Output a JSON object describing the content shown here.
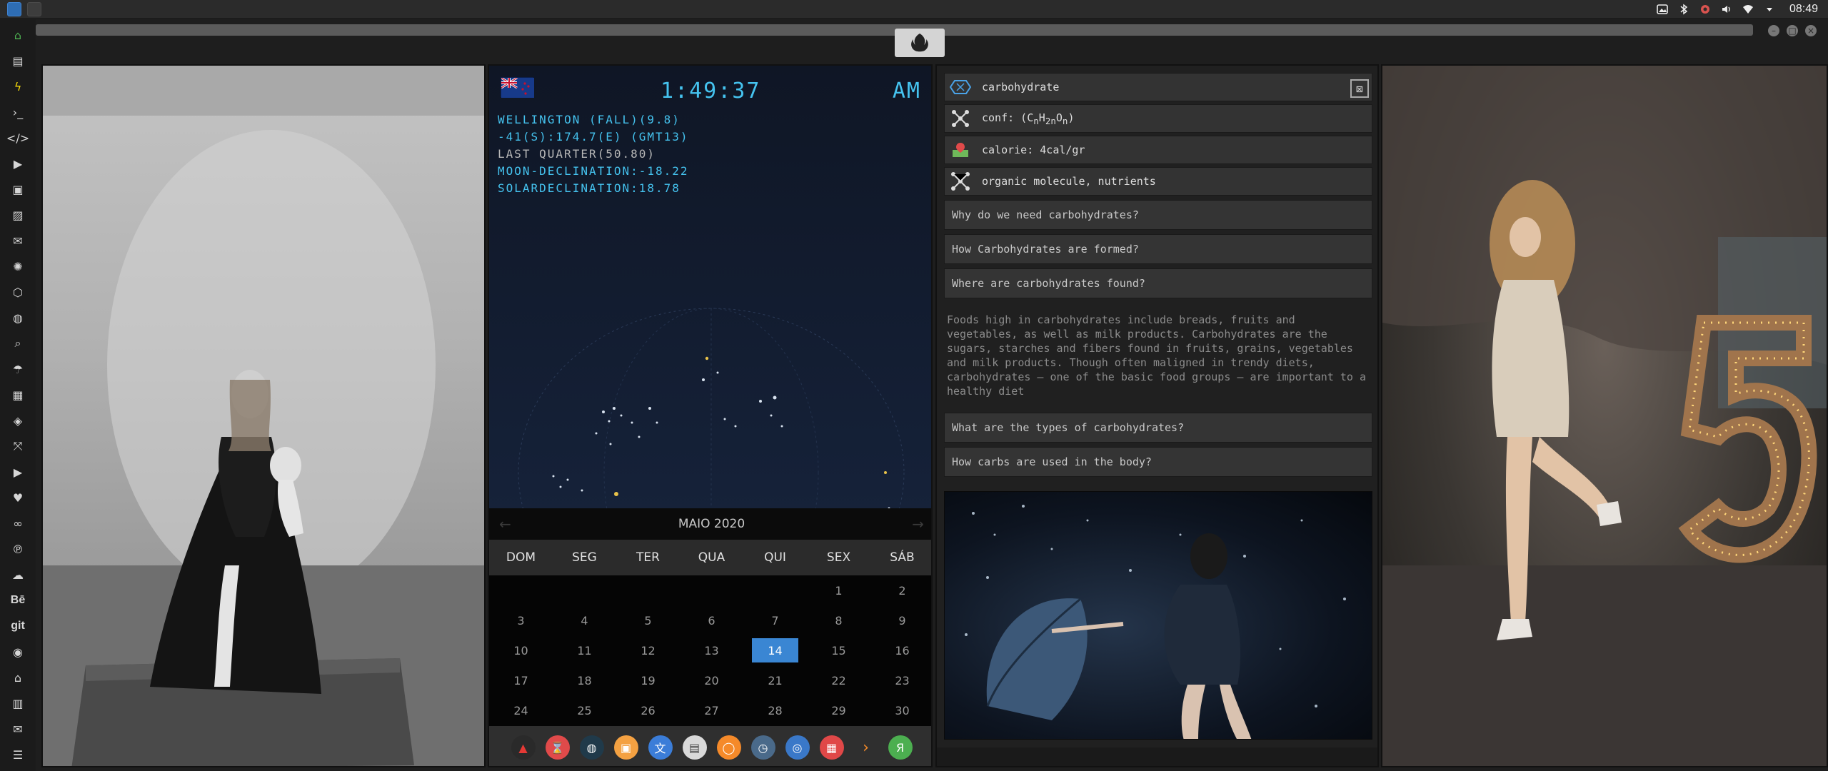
{
  "top_panel": {
    "clock": "08:49",
    "icons": [
      "image-icon",
      "bluetooth-icon",
      "settings-alert-icon",
      "volume-icon",
      "wifi-icon",
      "menu-down-icon"
    ]
  },
  "titlebar": {
    "buttons": [
      "minimize",
      "maximize",
      "close"
    ]
  },
  "dock": {
    "items": [
      "home",
      "document",
      "bolt",
      "terminal",
      "code",
      "play",
      "video",
      "image",
      "mail-open",
      "aperture",
      "hexagon",
      "globe",
      "search",
      "umbrella",
      "contacts",
      "diamond",
      "expand",
      "youtube",
      "heart",
      "infinity",
      "pinterest",
      "cloud",
      "Bē",
      "git",
      "github",
      "bank",
      "map",
      "mail",
      "storage"
    ]
  },
  "astro": {
    "time": "1:49:37",
    "ampm": "AM",
    "lines": [
      "WELLINGTON (FALL)(9.8)",
      "-41(S):174.7(E) (GMT13)",
      "LAST QUARTER(50.80)",
      "MOON-DECLINATION:-18.22",
      "SOLARDECLINATION:18.78"
    ]
  },
  "calendar": {
    "month": "MAIO 2020",
    "days": [
      "DOM",
      "SEG",
      "TER",
      "QUA",
      "QUI",
      "SEX",
      "SÁB"
    ],
    "cells": [
      "",
      "",
      "",
      "",
      "",
      "1",
      "2",
      "3",
      "4",
      "5",
      "6",
      "7",
      "8",
      "9",
      "10",
      "11",
      "12",
      "13",
      "14",
      "15",
      "16",
      "17",
      "18",
      "19",
      "20",
      "21",
      "22",
      "23",
      "24",
      "25",
      "26",
      "27",
      "28",
      "29",
      "30"
    ],
    "today": "14"
  },
  "carbo": {
    "title": "carbohydrate",
    "conf_prefix": "conf: (C",
    "conf_n": "n",
    "conf_h": "H",
    "conf_2n": "2n",
    "conf_o": "O",
    "conf_n2": "n",
    "conf_suffix": ")",
    "calorie": "calorie: 4cal/gr",
    "category": "organic molecule, nutrients",
    "questions": [
      "Why do we need carbohydrates?",
      "How Carbohydrates are formed?",
      "Where are carbohydrates found?"
    ],
    "paragraph": "Foods high in carbohydrates include breads, fruits and vegetables, as well as milk products. Carbohydrates are the sugars, starches and fibers found in fruits, grains, vegetables and milk products. Though often maligned in trendy diets, carbohydrates — one of the basic food groups — are important to a healthy diet",
    "questions2": [
      "What are the types of carbohydrates?",
      "How carbs are used in the body?"
    ]
  }
}
